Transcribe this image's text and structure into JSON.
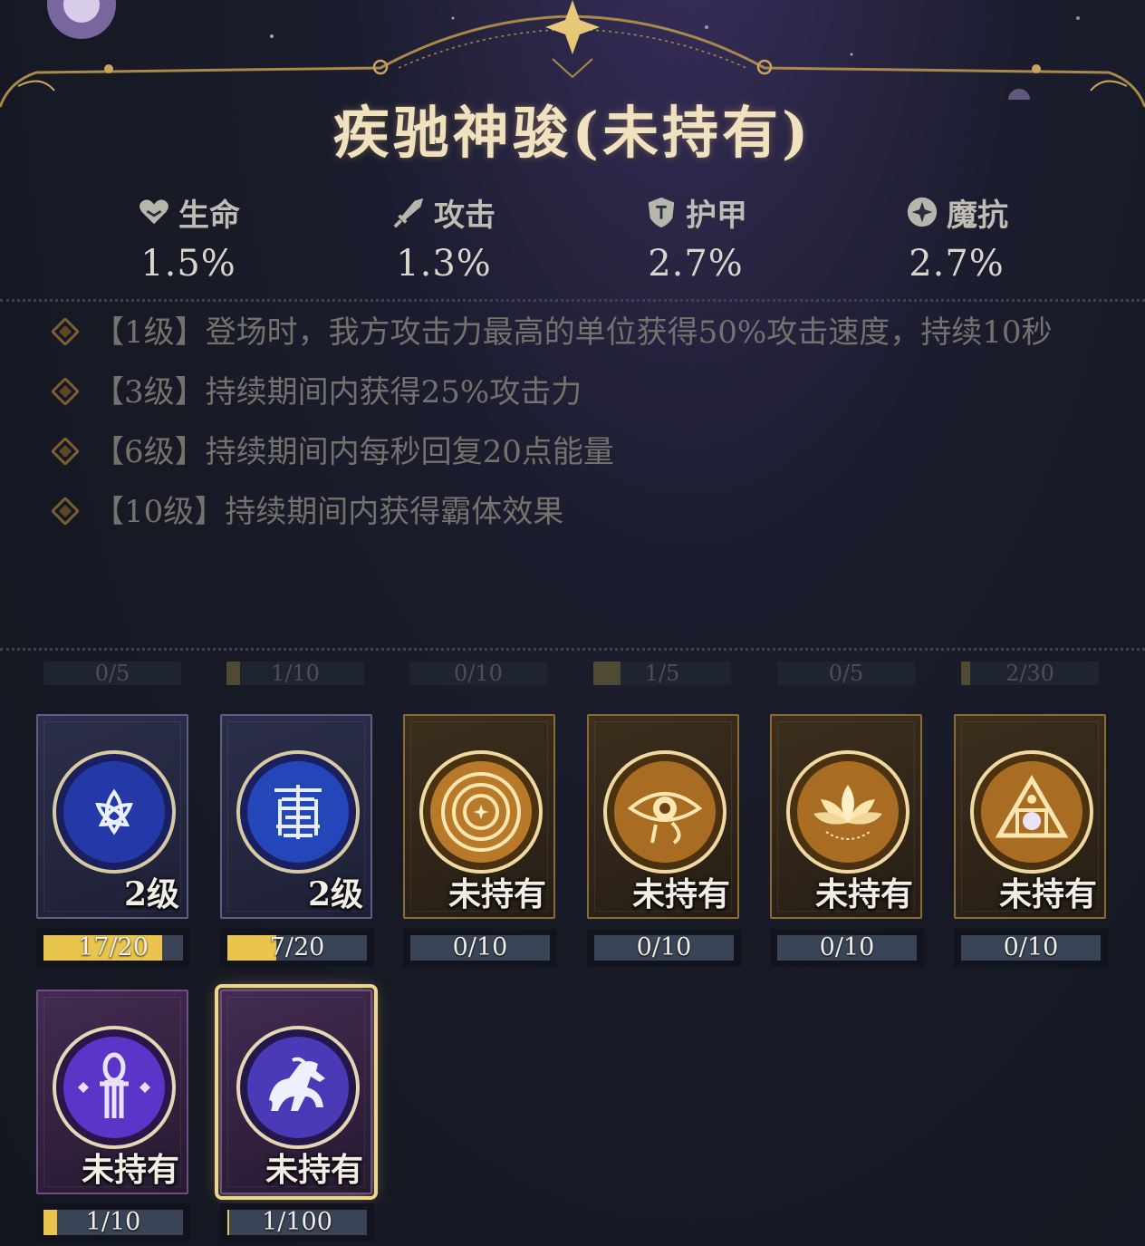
{
  "title": "疾驰神骏(未持有)",
  "stats": [
    {
      "icon": "heart-icon",
      "label": "生命",
      "value": "1.5%"
    },
    {
      "icon": "sword-icon",
      "label": "攻击",
      "value": "1.3%"
    },
    {
      "icon": "shield-icon",
      "label": "护甲",
      "value": "2.7%"
    },
    {
      "icon": "magic-orb-icon",
      "label": "魔抗",
      "value": "2.7%"
    }
  ],
  "skills": [
    {
      "text": "【1级】登场时，我方攻击力最高的单位获得50%攻击速度，持续10秒"
    },
    {
      "text": "【3级】持续期间内获得25%攻击力"
    },
    {
      "text": "【6级】持续期间内每秒回复20点能量"
    },
    {
      "text": "【10级】持续期间内获得霸体效果"
    }
  ],
  "top_progress": [
    {
      "text": "0/5",
      "fill": 0
    },
    {
      "text": "1/10",
      "fill": 0.1
    },
    {
      "text": "0/10",
      "fill": 0
    },
    {
      "text": "1/5",
      "fill": 0.2
    },
    {
      "text": "0/5",
      "fill": 0
    },
    {
      "text": "2/30",
      "fill": 0.067
    }
  ],
  "cards": [
    {
      "name": "crescent-triquetra-emblem",
      "rarity": "blue",
      "label": "2级",
      "progress_text": "17/20",
      "fill": 0.85,
      "selected": false
    },
    {
      "name": "chinese-seal-emblem",
      "rarity": "blue",
      "label": "2级",
      "progress_text": "7/20",
      "fill": 0.35,
      "selected": false
    },
    {
      "name": "labyrinth-sun-emblem",
      "rarity": "gold",
      "label": "未持有",
      "progress_text": "0/10",
      "fill": 0,
      "selected": false
    },
    {
      "name": "eye-of-horus-emblem",
      "rarity": "gold",
      "label": "未持有",
      "progress_text": "0/10",
      "fill": 0,
      "selected": false
    },
    {
      "name": "lotus-emblem",
      "rarity": "gold",
      "label": "未持有",
      "progress_text": "0/10",
      "fill": 0,
      "selected": false
    },
    {
      "name": "triangle-emblem",
      "rarity": "gold",
      "label": "未持有",
      "progress_text": "0/10",
      "fill": 0,
      "selected": false
    },
    {
      "name": "ankh-emblem",
      "rarity": "purple",
      "label": "未持有",
      "progress_text": "1/10",
      "fill": 0.1,
      "selected": false
    },
    {
      "name": "horse-emblem",
      "rarity": "purple-gold",
      "label": "未持有",
      "progress_text": "1/100",
      "fill": 0.01,
      "selected": true
    }
  ],
  "colors": {
    "gold": "#e9c54e",
    "title": "#f1e2bf",
    "bar_bg": "#3a4457"
  }
}
